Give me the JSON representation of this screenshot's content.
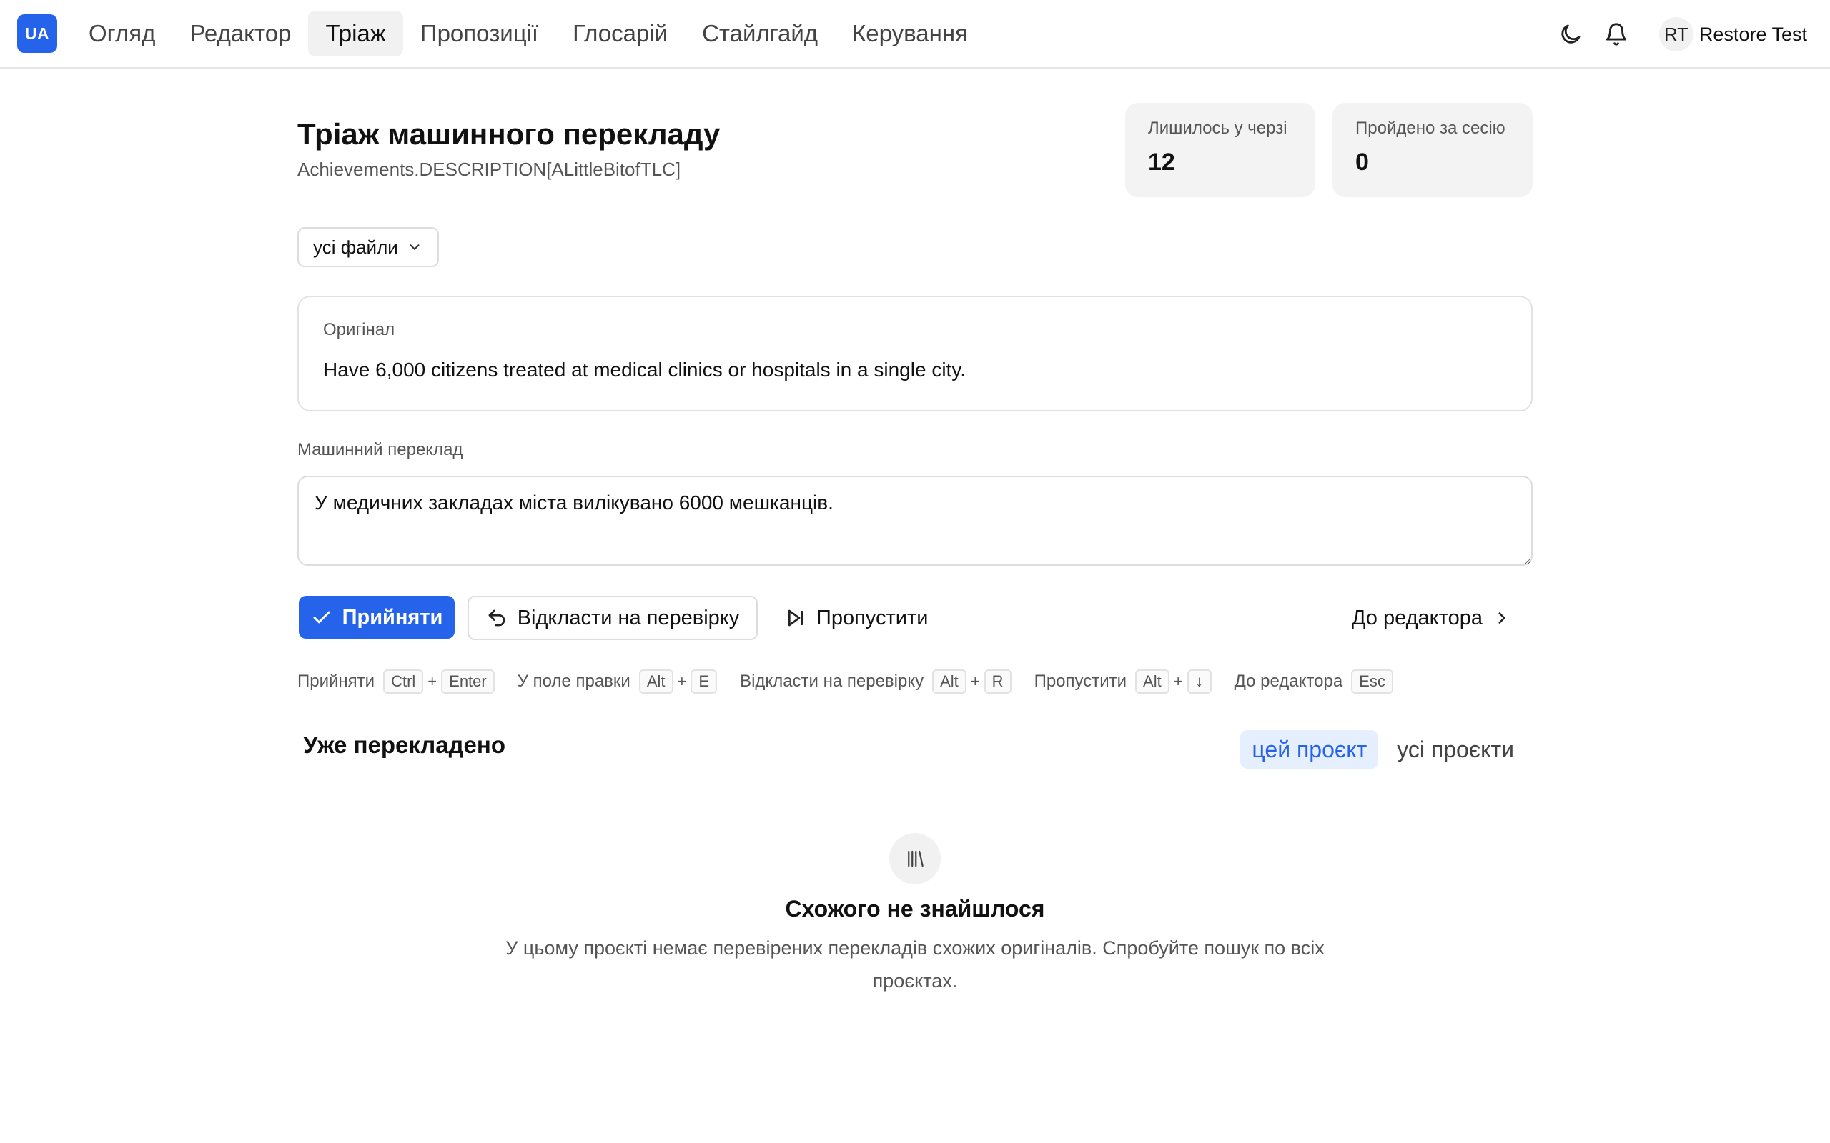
{
  "app": {
    "logo": "UA"
  },
  "nav": {
    "items": [
      {
        "label": "Огляд"
      },
      {
        "label": "Редактор"
      },
      {
        "label": "Тріаж"
      },
      {
        "label": "Пропозиції"
      },
      {
        "label": "Глосарій"
      },
      {
        "label": "Стайлгайд"
      },
      {
        "label": "Керування"
      }
    ],
    "active_index": 2
  },
  "user": {
    "initials": "RT",
    "name": "Restore Test"
  },
  "header": {
    "title": "Тріаж машинного перекладу",
    "key_path": "Achievements.DESCRIPTION[ALittleBitofTLC]"
  },
  "stats": [
    {
      "label": "Лишилось у черзі",
      "value": "12"
    },
    {
      "label": "Пройдено за сесію",
      "value": "0"
    }
  ],
  "filter": {
    "selected": "усі файли"
  },
  "source": {
    "label": "Оригінал",
    "text": "Have 6,000 citizens treated at medical clinics or hospitals in a single city."
  },
  "machine_translation": {
    "label": "Машинний переклад",
    "value": "У медичних закладах міста вилікувано 6000 мешканців."
  },
  "actions": {
    "accept": "Прийняти",
    "defer": "Відкласти на перевірку",
    "skip": "Пропустити",
    "to_editor": "До редактора"
  },
  "shortcuts": [
    {
      "label": "Прийняти",
      "keys": [
        "Ctrl",
        "Enter"
      ]
    },
    {
      "label": "У поле правки",
      "keys": [
        "Alt",
        "E"
      ]
    },
    {
      "label": "Відкласти на перевірку",
      "keys": [
        "Alt",
        "R"
      ]
    },
    {
      "label": "Пропустити",
      "keys": [
        "Alt",
        "↓"
      ]
    },
    {
      "label": "До редактора",
      "keys": [
        "Esc"
      ]
    }
  ],
  "already_translated": {
    "title": "Уже перекладено",
    "tabs": [
      {
        "label": "цей проєкт"
      },
      {
        "label": "усі проєкти"
      }
    ],
    "active_tab": 0,
    "empty_title": "Схожого не знайшлося",
    "empty_desc": "У цьому проєкті немає перевірених перекладів схожих оригіналів. Спробуйте пошук по всіх проєктах."
  },
  "colors": {
    "accent": "#2563eb",
    "accent_soft": "#e6effd"
  }
}
